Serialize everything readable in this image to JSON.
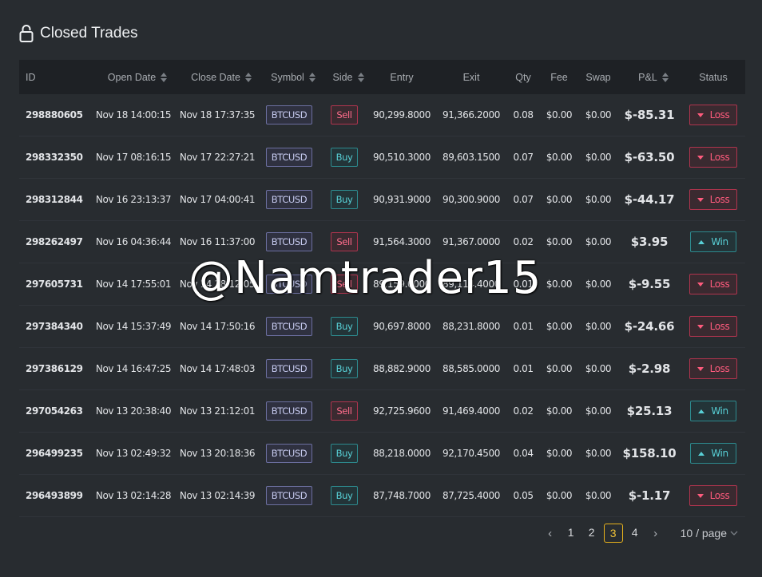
{
  "page": {
    "title": "Closed Trades",
    "icon": "lock-icon"
  },
  "columns": [
    {
      "key": "id",
      "label": "ID",
      "sortable": false
    },
    {
      "key": "open",
      "label": "Open Date",
      "sortable": true
    },
    {
      "key": "close",
      "label": "Close Date",
      "sortable": true
    },
    {
      "key": "symbol",
      "label": "Symbol",
      "sortable": true
    },
    {
      "key": "side",
      "label": "Side",
      "sortable": true
    },
    {
      "key": "entry",
      "label": "Entry",
      "sortable": false
    },
    {
      "key": "exit",
      "label": "Exit",
      "sortable": false
    },
    {
      "key": "qty",
      "label": "Qty",
      "sortable": false
    },
    {
      "key": "fee",
      "label": "Fee",
      "sortable": false
    },
    {
      "key": "swap",
      "label": "Swap",
      "sortable": false
    },
    {
      "key": "pnl",
      "label": "P&L",
      "sortable": true
    },
    {
      "key": "status",
      "label": "Status",
      "sortable": false
    }
  ],
  "rows": [
    {
      "id": "298880605",
      "open": "Nov 18 14:00:15",
      "close": "Nov 18 17:37:35",
      "symbol": "BTCUSD",
      "side": "Sell",
      "entry": "90,299.8000",
      "exit": "91,366.2000",
      "qty": "0.08",
      "fee": "$0.00",
      "swap": "$0.00",
      "pnl": "$-85.31",
      "status": "Loss"
    },
    {
      "id": "298332350",
      "open": "Nov 17 08:16:15",
      "close": "Nov 17 22:27:21",
      "symbol": "BTCUSD",
      "side": "Buy",
      "entry": "90,510.3000",
      "exit": "89,603.1500",
      "qty": "0.07",
      "fee": "$0.00",
      "swap": "$0.00",
      "pnl": "$-63.50",
      "status": "Loss"
    },
    {
      "id": "298312844",
      "open": "Nov 16 23:13:37",
      "close": "Nov 17 04:00:41",
      "symbol": "BTCUSD",
      "side": "Buy",
      "entry": "90,931.9000",
      "exit": "90,300.9000",
      "qty": "0.07",
      "fee": "$0.00",
      "swap": "$0.00",
      "pnl": "$-44.17",
      "status": "Loss"
    },
    {
      "id": "298262497",
      "open": "Nov 16 04:36:44",
      "close": "Nov 16 11:37:00",
      "symbol": "BTCUSD",
      "side": "Sell",
      "entry": "91,564.3000",
      "exit": "91,367.0000",
      "qty": "0.02",
      "fee": "$0.00",
      "swap": "$0.00",
      "pnl": "$3.95",
      "status": "Win"
    },
    {
      "id": "297605731",
      "open": "Nov 14 17:55:01",
      "close": "Nov 14 18:12:05",
      "symbol": "BTCUSD",
      "side": "Sell",
      "entry": "89,159.0000",
      "exit": "89,114.4000",
      "qty": "0.01",
      "fee": "$0.00",
      "swap": "$0.00",
      "pnl": "$-9.55",
      "status": "Loss"
    },
    {
      "id": "297384340",
      "open": "Nov 14 15:37:49",
      "close": "Nov 14 17:50:16",
      "symbol": "BTCUSD",
      "side": "Buy",
      "entry": "90,697.8000",
      "exit": "88,231.8000",
      "qty": "0.01",
      "fee": "$0.00",
      "swap": "$0.00",
      "pnl": "$-24.66",
      "status": "Loss"
    },
    {
      "id": "297386129",
      "open": "Nov 14 16:47:25",
      "close": "Nov 14 17:48:03",
      "symbol": "BTCUSD",
      "side": "Buy",
      "entry": "88,882.9000",
      "exit": "88,585.0000",
      "qty": "0.01",
      "fee": "$0.00",
      "swap": "$0.00",
      "pnl": "$-2.98",
      "status": "Loss"
    },
    {
      "id": "297054263",
      "open": "Nov 13 20:38:40",
      "close": "Nov 13 21:12:01",
      "symbol": "BTCUSD",
      "side": "Sell",
      "entry": "92,725.9600",
      "exit": "91,469.4000",
      "qty": "0.02",
      "fee": "$0.00",
      "swap": "$0.00",
      "pnl": "$25.13",
      "status": "Win"
    },
    {
      "id": "296499235",
      "open": "Nov 13 02:49:32",
      "close": "Nov 13 20:18:36",
      "symbol": "BTCUSD",
      "side": "Buy",
      "entry": "88,218.0000",
      "exit": "92,170.4500",
      "qty": "0.04",
      "fee": "$0.00",
      "swap": "$0.00",
      "pnl": "$158.10",
      "status": "Win"
    },
    {
      "id": "296493899",
      "open": "Nov 13 02:14:28",
      "close": "Nov 13 02:14:39",
      "symbol": "BTCUSD",
      "side": "Buy",
      "entry": "87,748.7000",
      "exit": "87,725.4000",
      "qty": "0.05",
      "fee": "$0.00",
      "swap": "$0.00",
      "pnl": "$-1.17",
      "status": "Loss"
    }
  ],
  "pagination": {
    "prev_icon": "chevron-left-icon",
    "next_icon": "chevron-right-icon",
    "pages": [
      "1",
      "2",
      "3",
      "4"
    ],
    "current": "3",
    "per_page": "10 / page",
    "per_page_icon": "chevron-down-icon"
  },
  "watermark": "@Namtrader15",
  "colors": {
    "background": "#282c30",
    "header_bg": "#1e2125",
    "loss": "#ff5b7d",
    "win": "#58d0d6",
    "symbol_badge": "#6c6fa0",
    "active_page": "#e8b31c"
  }
}
